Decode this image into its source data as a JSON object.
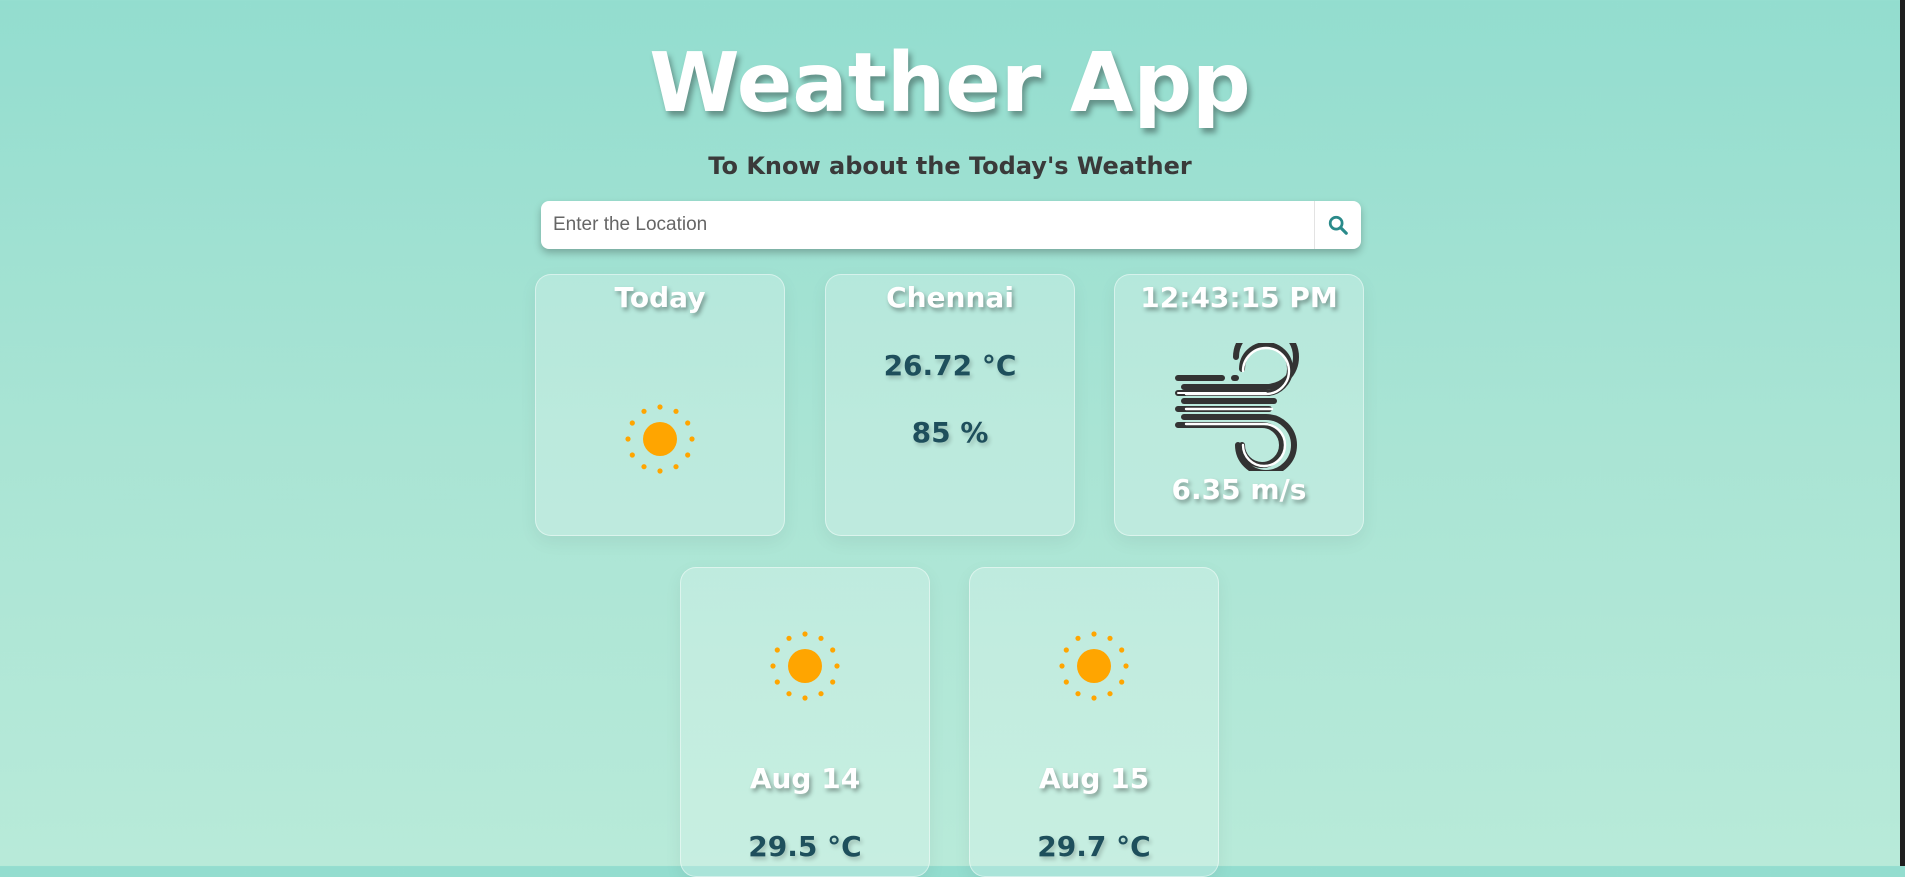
{
  "app": {
    "title": "Weather App",
    "subtitle": "To Know about the Today's Weather"
  },
  "search": {
    "placeholder": "Enter the Location",
    "icon": "search-icon"
  },
  "today_card": {
    "label": "Today",
    "icon": "sun-icon"
  },
  "city_card": {
    "city": "Chennai",
    "temperature": "26.72 °C",
    "humidity": "85 %"
  },
  "time_card": {
    "time": "12:43:15 PM",
    "icon": "wind-icon",
    "wind_speed": "6.35 m/s"
  },
  "forecast": [
    {
      "date": "Aug 14",
      "temperature": "29.5 °C",
      "icon": "sun-icon"
    },
    {
      "date": "Aug 15",
      "temperature": "29.7 °C",
      "icon": "sun-icon"
    }
  ],
  "colors": {
    "sun": "#ffa500",
    "accent": "#2a8a8a",
    "value_text": "#1e4f5c"
  }
}
